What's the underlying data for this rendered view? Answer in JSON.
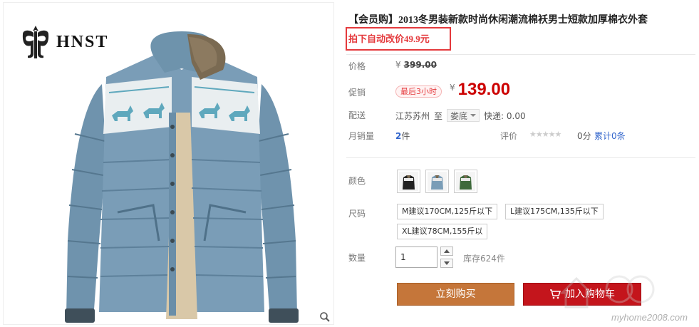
{
  "brand": {
    "name": "HNST"
  },
  "product": {
    "title": "【会员购】2013冬男装新款时尚休闲潮流棉袄男士短款加厚棉衣外套",
    "promo_note": "拍下自动改价49.9元"
  },
  "price": {
    "label": "价格",
    "currency": "¥",
    "original": "399.00",
    "promo_label": "促销",
    "promo_badge": "最后3小时",
    "promo": "139.00"
  },
  "shipping": {
    "label": "配送",
    "origin": "江苏苏州",
    "to": "至",
    "destination": "娄底",
    "fee": "快递: 0.00"
  },
  "sales": {
    "label": "月销量",
    "count": "2",
    "unit": "件",
    "rating_label": "评价",
    "score": "0分",
    "reviews": "累计0条"
  },
  "color": {
    "label": "颜色",
    "options": [
      "black",
      "blue",
      "green"
    ]
  },
  "size": {
    "label": "尺码",
    "options": [
      "M建议170CM,125斤以下",
      "L建议175CM,135斤以下",
      "XL建议78CM,155斤以"
    ]
  },
  "quantity": {
    "label": "数量",
    "value": "1",
    "stock": "库存624件"
  },
  "actions": {
    "buy": "立刻购买",
    "cart": "加入购物车"
  },
  "watermark": "myhome2008.com",
  "colors": {
    "price_red": "#c00",
    "promo_red": "#e4393c",
    "buy_brown": "#c5763a",
    "cart_red": "#c4151c",
    "link_blue": "#3366cc"
  }
}
